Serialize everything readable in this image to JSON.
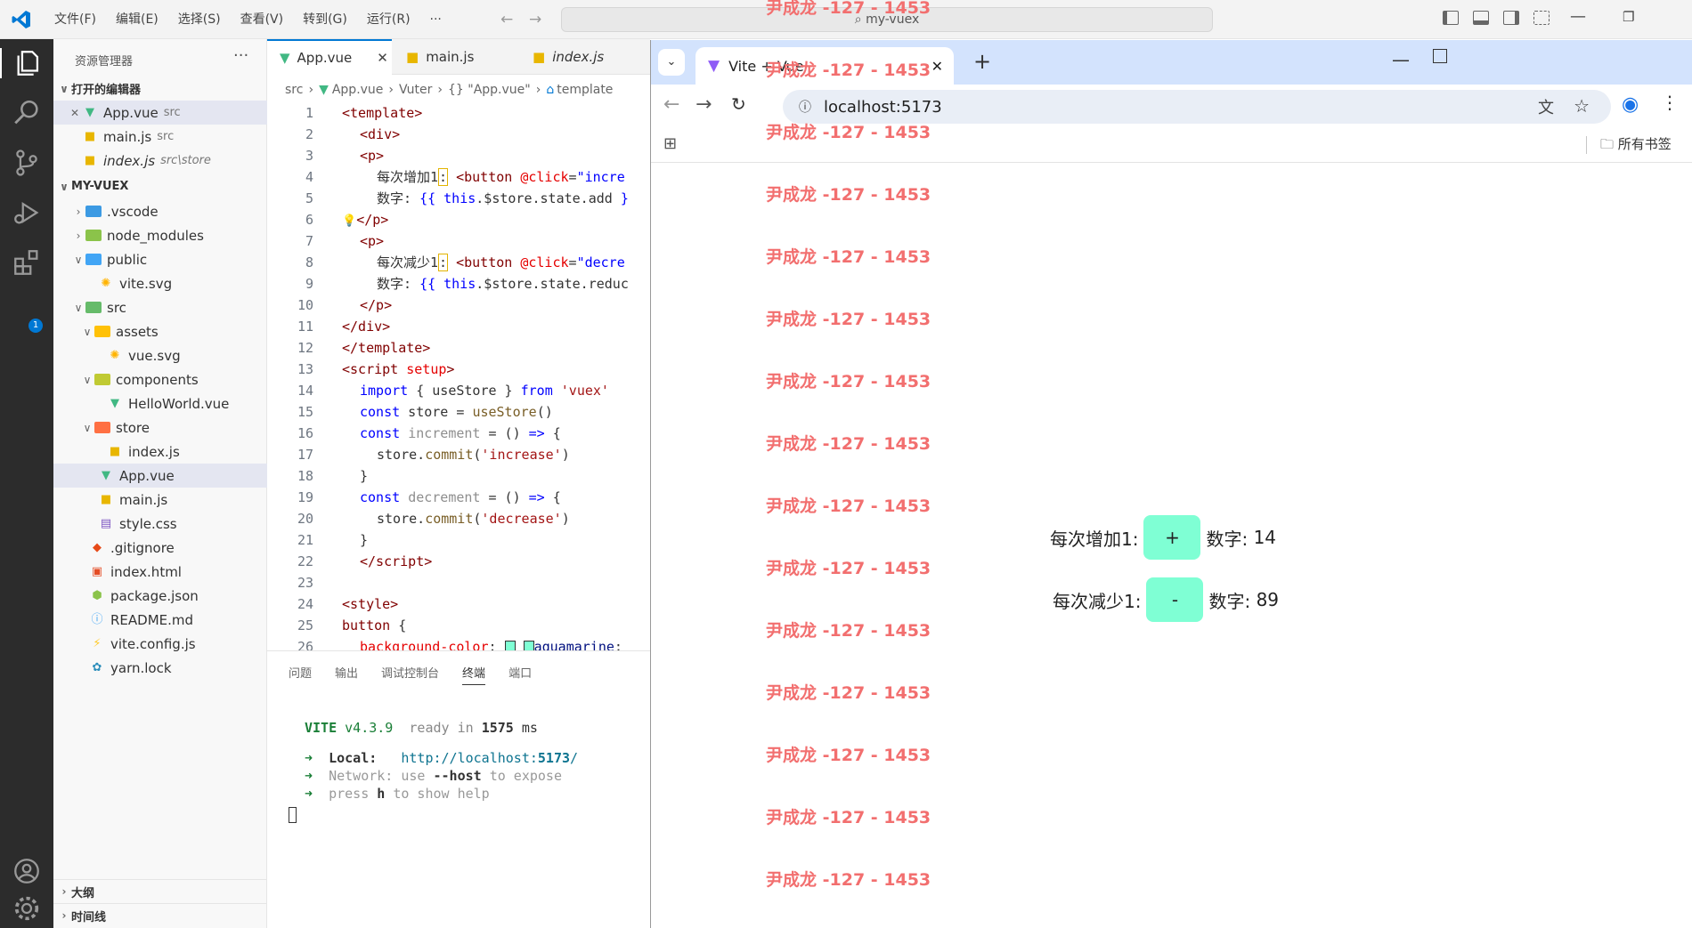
{
  "titlebar": {
    "menu": [
      "文件(F)",
      "编辑(E)",
      "选择(S)",
      "查看(V)",
      "转到(G)",
      "运行(R)",
      "···"
    ],
    "search": "my-vuex"
  },
  "activity": {
    "badge": "1"
  },
  "sidebar": {
    "title": "资源管理器",
    "open_editors_header": "打开的编辑器",
    "open_editors": [
      {
        "name": "App.vue",
        "hint": "src"
      },
      {
        "name": "main.js",
        "hint": "src"
      },
      {
        "name": "index.js",
        "hint": "src\\store"
      }
    ],
    "project_header": "MY-VUEX",
    "tree": [
      ".vscode",
      "node_modules",
      "public",
      "vite.svg",
      "src",
      "assets",
      "vue.svg",
      "components",
      "HelloWorld.vue",
      "store",
      "index.js",
      "App.vue",
      "main.js",
      "style.css",
      ".gitignore",
      "index.html",
      "package.json",
      "README.md",
      "vite.config.js",
      "yarn.lock"
    ],
    "outline": "大纲",
    "timeline": "时间线"
  },
  "editor": {
    "tabs": [
      "App.vue",
      "main.js",
      "index.js"
    ],
    "breadcrumb": [
      "src",
      "App.vue",
      "Vuter",
      "{} \"App.vue\"",
      "template"
    ],
    "lines": [
      "1",
      "2",
      "3",
      "4",
      "5",
      "6",
      "7",
      "8",
      "9",
      "10",
      "11",
      "12",
      "13",
      "14",
      "15",
      "16",
      "17",
      "18",
      "19",
      "20",
      "21",
      "22",
      "23",
      "24",
      "25",
      "26"
    ]
  },
  "panel": {
    "tabs": [
      "问题",
      "输出",
      "调试控制台",
      "终端",
      "端口"
    ],
    "term": {
      "vite": "VITE",
      "version": "v4.3.9",
      "ready": "ready in",
      "ms_value": "1575",
      "ms": "ms",
      "local_label": "Local:",
      "local_url_a": "http://localhost:",
      "local_port": "5173",
      "local_slash": "/",
      "network": "Network: use",
      "host_flag": "--host",
      "expose": "to expose",
      "press": "press",
      "h": "h",
      "help": "to show help"
    }
  },
  "browser": {
    "tab_title": "Vite + Vue",
    "url": "localhost:5173",
    "bookmarks_label": "所有书签",
    "watermark": "尹成龙 -127 - 1453",
    "inc_label": "每次增加1:",
    "inc_button": "+",
    "inc_value_label": "数字:",
    "inc_value": "14",
    "dec_label": "每次减少1:",
    "dec_button": "-",
    "dec_value_label": "数字:",
    "dec_value": "89"
  },
  "colors": {
    "accent": "#0078d4",
    "button": "#7fffd4",
    "watermark": "#f26f6f"
  }
}
